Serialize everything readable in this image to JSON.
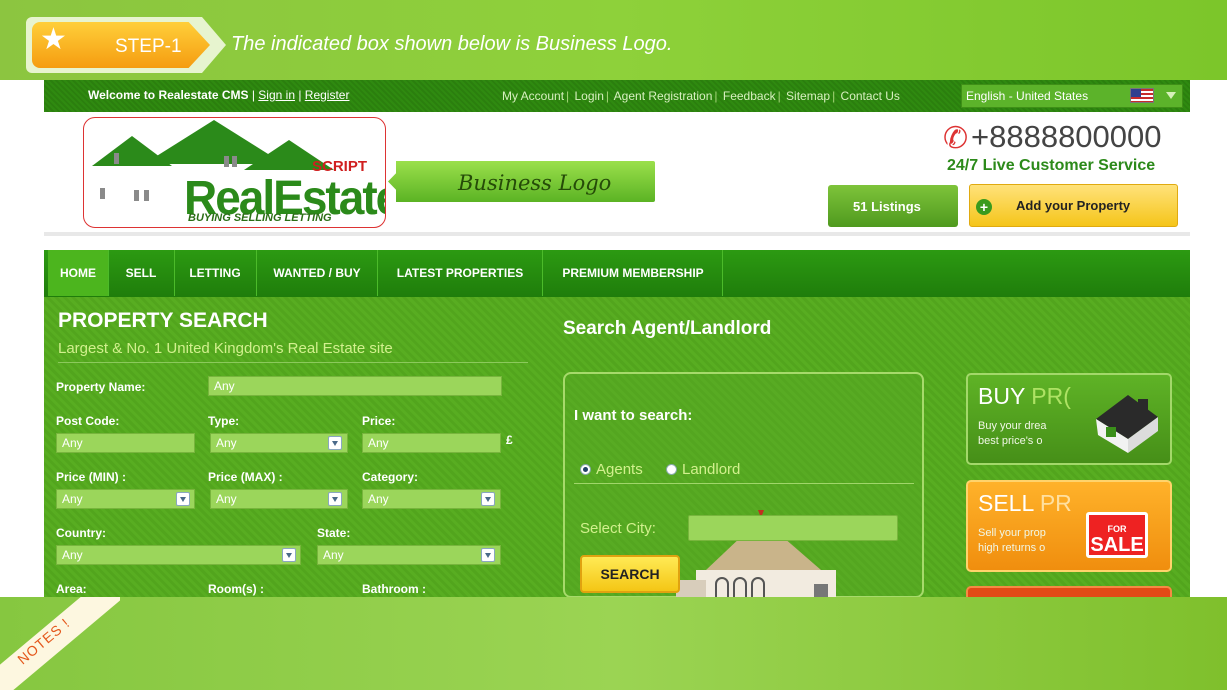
{
  "step": {
    "label": "STEP-1",
    "text": "The indicated box shown below is Business Logo."
  },
  "topbar": {
    "welcome": "Welcome to Realestate CMS",
    "sign_in": "Sign in",
    "register": "Register",
    "links": [
      "My Account",
      "Login",
      "Agent Registration",
      "Feedback",
      "Sitemap",
      "Contact Us"
    ],
    "language": "English - United States"
  },
  "logo": {
    "script": "SCRIPT",
    "brand": "RealEstate",
    "tagline": "BUYING SELLING LETTING"
  },
  "business_logo_label": "Business Logo",
  "contact": {
    "phone": "+8888800000",
    "service": "24/7 Live Customer Service"
  },
  "buttons": {
    "listings": "51 Listings",
    "add_property": "Add your Property",
    "search": "SEARCH"
  },
  "nav": [
    "HOME",
    "SELL",
    "LETTING",
    "WANTED / BUY",
    "LATEST PROPERTIES",
    "PREMIUM MEMBERSHIP"
  ],
  "property_search": {
    "title": "PROPERTY SEARCH",
    "subtitle": "Largest & No. 1 United Kingdom's Real Estate site",
    "property_name_label": "Property Name:",
    "property_name_value": "Any",
    "post_code_label": "Post Code:",
    "post_code_value": "Any",
    "type_label": "Type:",
    "type_value": "Any",
    "price_label": "Price:",
    "price_value": "Any",
    "currency": "£",
    "price_min_label": "Price (MIN) :",
    "price_min_value": "Any",
    "price_max_label": "Price (MAX) :",
    "price_max_value": "Any",
    "category_label": "Category:",
    "category_value": "Any",
    "country_label": "Country:",
    "country_value": "Any",
    "state_label": "State:",
    "state_value": "Any",
    "area_label": "Area:",
    "rooms_label": "Room(s) :",
    "bathroom_label": "Bathroom :"
  },
  "agent_search": {
    "title": "Search Agent/Landlord",
    "want_label": "I want to search:",
    "options": [
      "Agents",
      "Landlord"
    ],
    "selected": "Agents",
    "city_label": "Select City:"
  },
  "promos": {
    "buy": {
      "title_a": "BUY ",
      "title_b": "PR(",
      "line1": "Buy your drea",
      "line2": "best price's o"
    },
    "sell": {
      "title_a": "SELL ",
      "title_b": "PR",
      "line1": "Sell your prop",
      "line2": "high returns o",
      "sign_small": "FOR",
      "sign_big": "SALE"
    }
  },
  "notes_label": "NOTES !",
  "colors": {
    "brand_green": "#2c9a12",
    "accent_yellow": "#f5c51a",
    "accent_orange": "#f08e0e",
    "logo_red": "#d01f1f"
  }
}
